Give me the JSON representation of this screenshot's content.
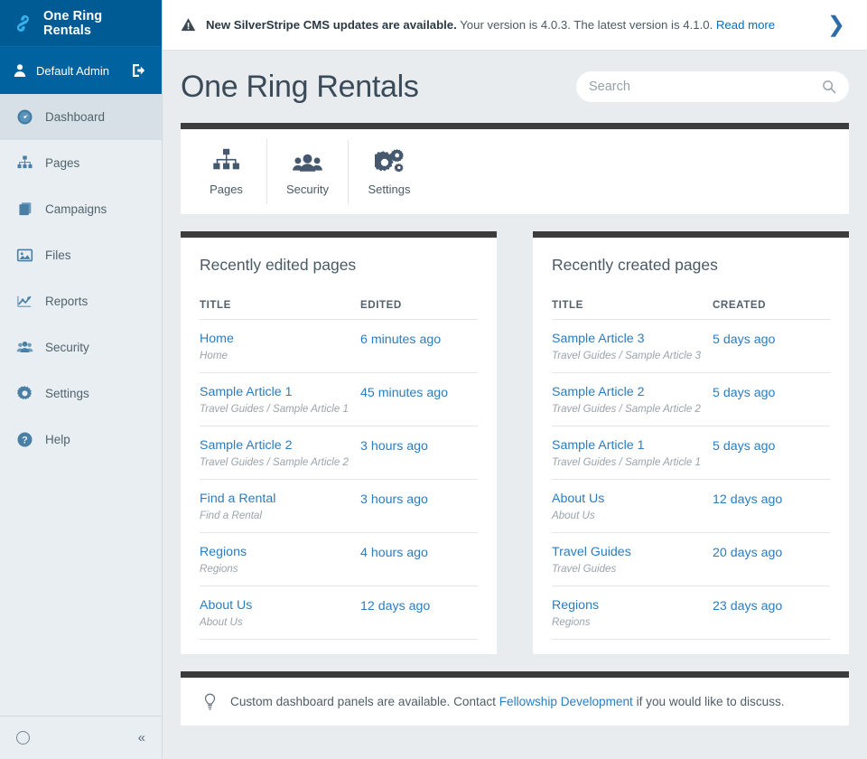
{
  "sidebar": {
    "brand": {
      "name": "One Ring Rentals",
      "logo_icon": "silverstripe-logo-icon"
    },
    "user": {
      "name": "Default Admin",
      "icon": "user-icon",
      "logout_icon": "logout-icon"
    },
    "items": [
      {
        "label": "Dashboard",
        "icon": "dashboard-icon",
        "active": true
      },
      {
        "label": "Pages",
        "icon": "pages-sitemap-icon",
        "active": false
      },
      {
        "label": "Campaigns",
        "icon": "campaigns-stack-icon",
        "active": false
      },
      {
        "label": "Files",
        "icon": "files-image-icon",
        "active": false
      },
      {
        "label": "Reports",
        "icon": "reports-chart-icon",
        "active": false
      },
      {
        "label": "Security",
        "icon": "security-people-icon",
        "active": false
      },
      {
        "label": "Settings",
        "icon": "settings-gear-icon",
        "active": false
      },
      {
        "label": "Help",
        "icon": "help-question-icon",
        "active": false
      }
    ],
    "footer": {
      "status_icon": "circle-icon",
      "collapse_icon": "collapse-double-chevron-left-icon",
      "collapse_label": "«"
    }
  },
  "notice": {
    "warn_icon": "warning-triangle-icon",
    "bold_text": "New SilverStripe CMS updates are available.",
    "body_text": " Your version is 4.0.3. The latest version is 4.1.0. ",
    "link_text": "Read more",
    "chevron_icon": "chevron-right-icon",
    "chevron_label": "❯"
  },
  "header": {
    "title": "One Ring Rentals",
    "search": {
      "placeholder": "Search",
      "value": "",
      "icon": "search-icon"
    }
  },
  "shortcuts": [
    {
      "label": "Pages",
      "icon": "pages-sitemap-icon"
    },
    {
      "label": "Security",
      "icon": "security-people-icon"
    },
    {
      "label": "Settings",
      "icon": "settings-gears-icon"
    }
  ],
  "recently_edited": {
    "title": "Recently edited pages",
    "columns": [
      "TITLE",
      "EDITED"
    ],
    "rows": [
      {
        "title": "Home",
        "path": "Home",
        "date": "6 minutes ago"
      },
      {
        "title": "Sample Article 1",
        "path": "Travel Guides / Sample Article 1",
        "date": "45 minutes ago"
      },
      {
        "title": "Sample Article 2",
        "path": "Travel Guides / Sample Article 2",
        "date": "3 hours ago"
      },
      {
        "title": "Find a Rental",
        "path": "Find a Rental",
        "date": "3 hours ago"
      },
      {
        "title": "Regions",
        "path": "Regions",
        "date": "4 hours ago"
      },
      {
        "title": "About Us",
        "path": "About Us",
        "date": "12 days ago"
      }
    ]
  },
  "recently_created": {
    "title": "Recently created pages",
    "columns": [
      "TITLE",
      "CREATED"
    ],
    "rows": [
      {
        "title": "Sample Article 3",
        "path": "Travel Guides / Sample Article 3",
        "date": "5 days ago"
      },
      {
        "title": "Sample Article 2",
        "path": "Travel Guides / Sample Article 2",
        "date": "5 days ago"
      },
      {
        "title": "Sample Article 1",
        "path": "Travel Guides / Sample Article 1",
        "date": "5 days ago"
      },
      {
        "title": "About Us",
        "path": "About Us",
        "date": "12 days ago"
      },
      {
        "title": "Travel Guides",
        "path": "Travel Guides",
        "date": "20 days ago"
      },
      {
        "title": "Regions",
        "path": "Regions",
        "date": "23 days ago"
      }
    ]
  },
  "tip": {
    "icon": "lightbulb-icon",
    "before": "Custom dashboard panels are available. Contact ",
    "link": "Fellowship Development",
    "after": " if you would like to discuss."
  },
  "colors": {
    "brand_blue": "#005a93",
    "user_blue": "#00629e",
    "sidebar_bg": "#e8eef1",
    "sidebar_active": "#d6e0e6",
    "link_blue": "#2b7dc0",
    "notice_link": "#0071c4",
    "panel_top_bar": "#3c3c3c",
    "page_bg": "#e8ecef",
    "icon_slate": "#4a5f72"
  }
}
